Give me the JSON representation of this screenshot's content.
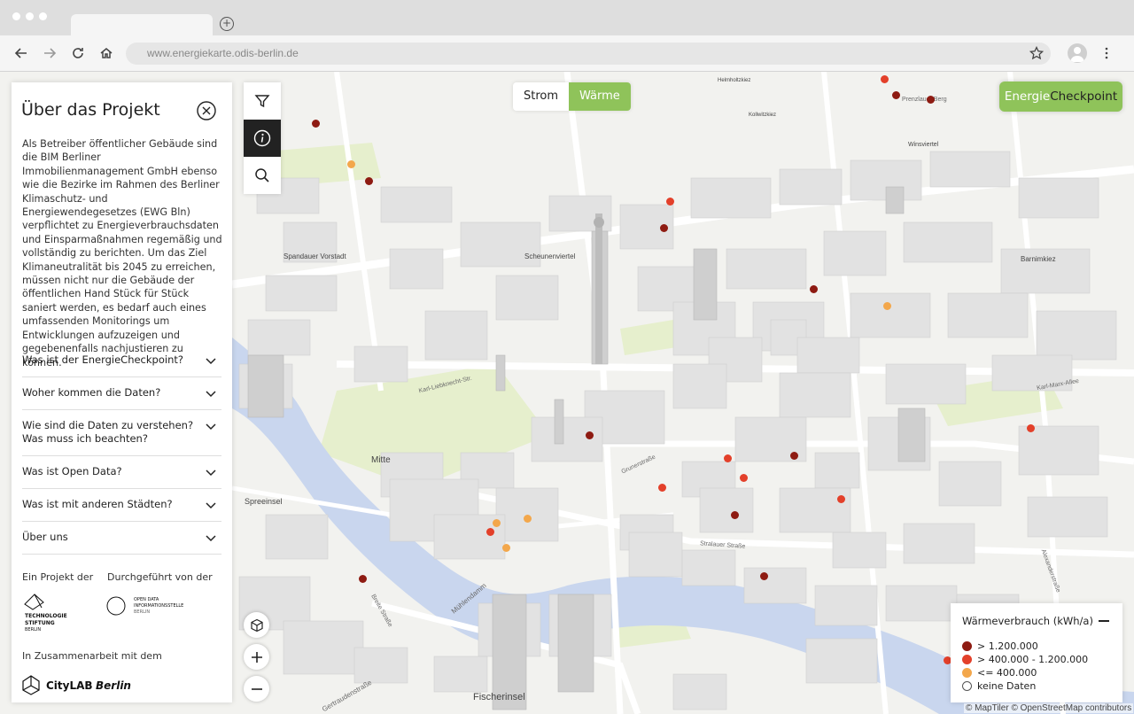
{
  "browser": {
    "url": "www.energiekarte.odis-berlin.de",
    "icons": [
      "back-icon",
      "forward-icon",
      "reload-icon",
      "home-icon",
      "star-icon",
      "profile-icon",
      "menu-icon",
      "new-tab-icon"
    ]
  },
  "panel": {
    "title": "Über das Projekt",
    "body": "Als Betreiber öffentlicher Gebäude sind die BIM Berliner Immobilienmanagement GmbH ebenso wie die Bezirke im Rahmen des Berliner Klimaschutz- und Energiewendegesetzes (EWG Bln) verpflichtet zu Energieverbrauchsdaten und Einsparmaßnahmen regemäßig und vollständig zu berichten. Um das Ziel Klimaneutralität bis 2045 zu erreichen, müssen nicht nur die Gebäude der öffentlichen Hand Stück für Stück saniert werden, es bedarf auch eines umfassenden Monitorings um Entwicklungen aufzuzeigen und gegebenenfalls nachjustieren zu können.",
    "faq": [
      {
        "label": "Was ist der EnergieCheckpoint?"
      },
      {
        "label": "Woher kommen die Daten?"
      },
      {
        "label": "Wie sind die Daten zu verstehen? Was muss ich beachten?"
      },
      {
        "label": "Was ist Open Data?"
      },
      {
        "label": "Was ist mit anderen Städten?"
      },
      {
        "label": "Über uns"
      }
    ],
    "credits": {
      "project_by": "Ein Projekt der",
      "done_by": "Durchgeführt von der",
      "cooperation": "In Zusammenarbeit mit dem",
      "tsb_logo": [
        "TECHNOLOGIE",
        "STIFTUNG",
        "BERLIN"
      ],
      "odis_logo": [
        "OPEN DATA",
        "INFORMATIONSSTELLE",
        "BERLIN"
      ],
      "citylab_logo": [
        "CityLAB",
        "Berlin"
      ]
    }
  },
  "toggle": {
    "strom": "Strom",
    "waerme": "Wärme",
    "selected": "waerme"
  },
  "brand": {
    "part1": "Energie",
    "part2": "Checkpoint"
  },
  "legend": {
    "title": "Wärmeverbrauch (kWh/a)",
    "items": [
      {
        "label": "> 1.200.000",
        "color": "#8e1b12"
      },
      {
        "label": "> 400.000 - 1.200.000",
        "color": "#e3402a"
      },
      {
        "label": "<= 400.000",
        "color": "#f3a74b"
      },
      {
        "label": "keine Daten",
        "color": "#ffffff"
      }
    ]
  },
  "map": {
    "districts": [
      "Mitte",
      "Spreeinsel",
      "Fischerinsel",
      "Spandauer Vorstadt",
      "Scheunenviertel",
      "Barnimkiez",
      "Winsviertel",
      "Helmholtzkiez",
      "Kollwitzkiez"
    ],
    "streets": [
      "Prenzlauer Berg",
      "Karl-Liebknecht-Str.",
      "Grunerstraße",
      "Stralauer Straße",
      "Mühlendamm",
      "Breite Straße",
      "Gertraudenstraße",
      "Karl-Marx-Allee",
      "Alexanderstraße"
    ],
    "colors": {
      "water": "#c9d6ee",
      "park": "#e6efcd",
      "road": "#ffffff",
      "building": "#e2e2e2"
    }
  },
  "attribution": "© MapTiler © OpenStreetMap contributors"
}
